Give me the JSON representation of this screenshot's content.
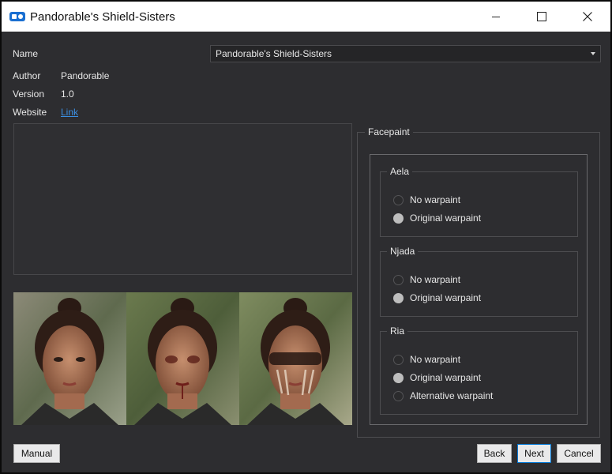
{
  "window": {
    "title": "Pandorable's Shield-Sisters"
  },
  "fields": {
    "name_label": "Name",
    "name_value": "Pandorable's Shield-Sisters",
    "author_label": "Author",
    "author_value": "Pandorable",
    "version_label": "Version",
    "version_value": "1.0",
    "website_label": "Website",
    "website_link": "Link"
  },
  "facepaint": {
    "title": "Facepaint",
    "groups": [
      {
        "name": "Aela",
        "options": [
          {
            "label": "No warpaint",
            "checked": false
          },
          {
            "label": "Original warpaint",
            "checked": true
          }
        ]
      },
      {
        "name": "Njada",
        "options": [
          {
            "label": "No warpaint",
            "checked": false
          },
          {
            "label": "Original warpaint",
            "checked": true
          }
        ]
      },
      {
        "name": "Ria",
        "options": [
          {
            "label": "No warpaint",
            "checked": false
          },
          {
            "label": "Original warpaint",
            "checked": true
          },
          {
            "label": "Alternative warpaint",
            "checked": false
          }
        ]
      }
    ]
  },
  "buttons": {
    "manual": "Manual",
    "back": "Back",
    "next": "Next",
    "cancel": "Cancel"
  },
  "icons": {
    "app": "mod-organizer-icon",
    "minimize": "minimize-icon",
    "maximize": "maximize-icon",
    "close": "close-icon",
    "dropdown": "chevron-down-icon"
  },
  "colors": {
    "background": "#2d2d30",
    "link": "#3b8ee0",
    "focus": "#0078d7"
  }
}
